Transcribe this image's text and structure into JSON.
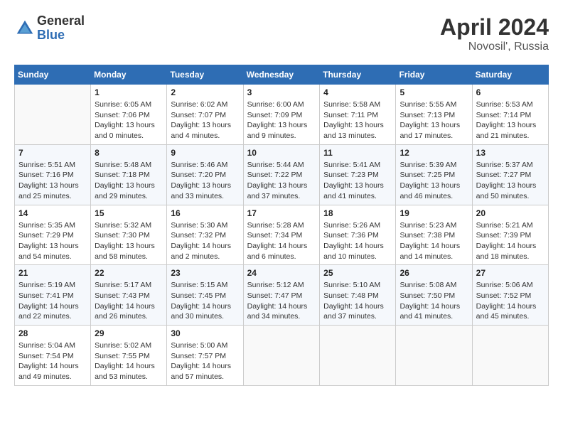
{
  "header": {
    "logo_general": "General",
    "logo_blue": "Blue",
    "month_title": "April 2024",
    "location": "Novosil', Russia"
  },
  "weekdays": [
    "Sunday",
    "Monday",
    "Tuesday",
    "Wednesday",
    "Thursday",
    "Friday",
    "Saturday"
  ],
  "weeks": [
    [
      {
        "day": "",
        "info": ""
      },
      {
        "day": "1",
        "info": "Sunrise: 6:05 AM\nSunset: 7:06 PM\nDaylight: 13 hours\nand 0 minutes."
      },
      {
        "day": "2",
        "info": "Sunrise: 6:02 AM\nSunset: 7:07 PM\nDaylight: 13 hours\nand 4 minutes."
      },
      {
        "day": "3",
        "info": "Sunrise: 6:00 AM\nSunset: 7:09 PM\nDaylight: 13 hours\nand 9 minutes."
      },
      {
        "day": "4",
        "info": "Sunrise: 5:58 AM\nSunset: 7:11 PM\nDaylight: 13 hours\nand 13 minutes."
      },
      {
        "day": "5",
        "info": "Sunrise: 5:55 AM\nSunset: 7:13 PM\nDaylight: 13 hours\nand 17 minutes."
      },
      {
        "day": "6",
        "info": "Sunrise: 5:53 AM\nSunset: 7:14 PM\nDaylight: 13 hours\nand 21 minutes."
      }
    ],
    [
      {
        "day": "7",
        "info": "Sunrise: 5:51 AM\nSunset: 7:16 PM\nDaylight: 13 hours\nand 25 minutes."
      },
      {
        "day": "8",
        "info": "Sunrise: 5:48 AM\nSunset: 7:18 PM\nDaylight: 13 hours\nand 29 minutes."
      },
      {
        "day": "9",
        "info": "Sunrise: 5:46 AM\nSunset: 7:20 PM\nDaylight: 13 hours\nand 33 minutes."
      },
      {
        "day": "10",
        "info": "Sunrise: 5:44 AM\nSunset: 7:22 PM\nDaylight: 13 hours\nand 37 minutes."
      },
      {
        "day": "11",
        "info": "Sunrise: 5:41 AM\nSunset: 7:23 PM\nDaylight: 13 hours\nand 41 minutes."
      },
      {
        "day": "12",
        "info": "Sunrise: 5:39 AM\nSunset: 7:25 PM\nDaylight: 13 hours\nand 46 minutes."
      },
      {
        "day": "13",
        "info": "Sunrise: 5:37 AM\nSunset: 7:27 PM\nDaylight: 13 hours\nand 50 minutes."
      }
    ],
    [
      {
        "day": "14",
        "info": "Sunrise: 5:35 AM\nSunset: 7:29 PM\nDaylight: 13 hours\nand 54 minutes."
      },
      {
        "day": "15",
        "info": "Sunrise: 5:32 AM\nSunset: 7:30 PM\nDaylight: 13 hours\nand 58 minutes."
      },
      {
        "day": "16",
        "info": "Sunrise: 5:30 AM\nSunset: 7:32 PM\nDaylight: 14 hours\nand 2 minutes."
      },
      {
        "day": "17",
        "info": "Sunrise: 5:28 AM\nSunset: 7:34 PM\nDaylight: 14 hours\nand 6 minutes."
      },
      {
        "day": "18",
        "info": "Sunrise: 5:26 AM\nSunset: 7:36 PM\nDaylight: 14 hours\nand 10 minutes."
      },
      {
        "day": "19",
        "info": "Sunrise: 5:23 AM\nSunset: 7:38 PM\nDaylight: 14 hours\nand 14 minutes."
      },
      {
        "day": "20",
        "info": "Sunrise: 5:21 AM\nSunset: 7:39 PM\nDaylight: 14 hours\nand 18 minutes."
      }
    ],
    [
      {
        "day": "21",
        "info": "Sunrise: 5:19 AM\nSunset: 7:41 PM\nDaylight: 14 hours\nand 22 minutes."
      },
      {
        "day": "22",
        "info": "Sunrise: 5:17 AM\nSunset: 7:43 PM\nDaylight: 14 hours\nand 26 minutes."
      },
      {
        "day": "23",
        "info": "Sunrise: 5:15 AM\nSunset: 7:45 PM\nDaylight: 14 hours\nand 30 minutes."
      },
      {
        "day": "24",
        "info": "Sunrise: 5:12 AM\nSunset: 7:47 PM\nDaylight: 14 hours\nand 34 minutes."
      },
      {
        "day": "25",
        "info": "Sunrise: 5:10 AM\nSunset: 7:48 PM\nDaylight: 14 hours\nand 37 minutes."
      },
      {
        "day": "26",
        "info": "Sunrise: 5:08 AM\nSunset: 7:50 PM\nDaylight: 14 hours\nand 41 minutes."
      },
      {
        "day": "27",
        "info": "Sunrise: 5:06 AM\nSunset: 7:52 PM\nDaylight: 14 hours\nand 45 minutes."
      }
    ],
    [
      {
        "day": "28",
        "info": "Sunrise: 5:04 AM\nSunset: 7:54 PM\nDaylight: 14 hours\nand 49 minutes."
      },
      {
        "day": "29",
        "info": "Sunrise: 5:02 AM\nSunset: 7:55 PM\nDaylight: 14 hours\nand 53 minutes."
      },
      {
        "day": "30",
        "info": "Sunrise: 5:00 AM\nSunset: 7:57 PM\nDaylight: 14 hours\nand 57 minutes."
      },
      {
        "day": "",
        "info": ""
      },
      {
        "day": "",
        "info": ""
      },
      {
        "day": "",
        "info": ""
      },
      {
        "day": "",
        "info": ""
      }
    ]
  ]
}
